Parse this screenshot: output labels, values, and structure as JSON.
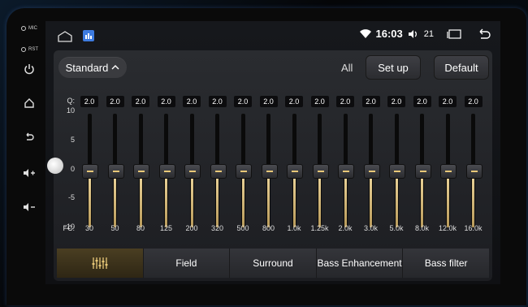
{
  "device": {
    "mic_label": "MIC",
    "rst_label": "RST"
  },
  "status": {
    "time": "16:03",
    "volume": "21"
  },
  "eq": {
    "preset": "Standard",
    "all_label": "All",
    "setup_label": "Set up",
    "default_label": "Default",
    "q_label": "Q:",
    "fc_label": "FC:",
    "y_ticks": [
      "10",
      "5",
      "0",
      "-5",
      "-10"
    ],
    "bands": [
      {
        "fc": "30",
        "q": "2.0",
        "gain": 0
      },
      {
        "fc": "50",
        "q": "2.0",
        "gain": 0
      },
      {
        "fc": "80",
        "q": "2.0",
        "gain": 0
      },
      {
        "fc": "125",
        "q": "2.0",
        "gain": 0
      },
      {
        "fc": "200",
        "q": "2.0",
        "gain": 0
      },
      {
        "fc": "320",
        "q": "2.0",
        "gain": 0
      },
      {
        "fc": "500",
        "q": "2.0",
        "gain": 0
      },
      {
        "fc": "800",
        "q": "2.0",
        "gain": 0
      },
      {
        "fc": "1.0k",
        "q": "2.0",
        "gain": 0
      },
      {
        "fc": "1.25k",
        "q": "2.0",
        "gain": 0
      },
      {
        "fc": "2.0k",
        "q": "2.0",
        "gain": 0
      },
      {
        "fc": "3.0k",
        "q": "2.0",
        "gain": 0
      },
      {
        "fc": "5.0k",
        "q": "2.0",
        "gain": 0
      },
      {
        "fc": "8.0k",
        "q": "2.0",
        "gain": 0
      },
      {
        "fc": "12.0k",
        "q": "2.0",
        "gain": 0
      },
      {
        "fc": "16.0k",
        "q": "2.0",
        "gain": 0
      }
    ]
  },
  "tabs": [
    {
      "label": "",
      "active": true,
      "icon": "equalizer-icon"
    },
    {
      "label": "Field",
      "active": false
    },
    {
      "label": "Surround",
      "active": false
    },
    {
      "label": "Bass Enhancement",
      "active": false
    },
    {
      "label": "Bass filter",
      "active": false
    }
  ],
  "colors": {
    "accent": "#e8c878",
    "active_tab": "#4a3e22"
  }
}
